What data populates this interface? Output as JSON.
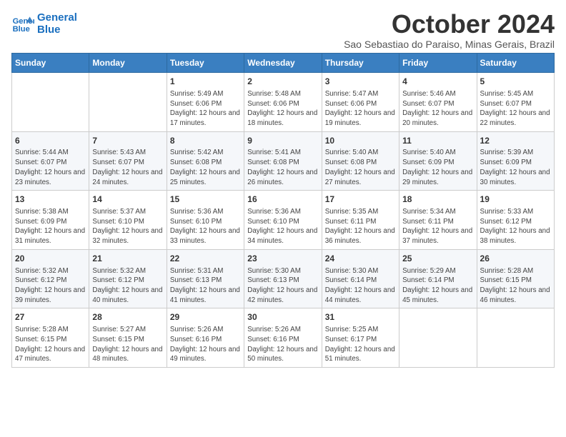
{
  "logo": {
    "line1": "General",
    "line2": "Blue"
  },
  "title": "October 2024",
  "subtitle": "Sao Sebastiao do Paraiso, Minas Gerais, Brazil",
  "weekdays": [
    "Sunday",
    "Monday",
    "Tuesday",
    "Wednesday",
    "Thursday",
    "Friday",
    "Saturday"
  ],
  "weeks": [
    [
      {
        "day": "",
        "info": ""
      },
      {
        "day": "",
        "info": ""
      },
      {
        "day": "1",
        "info": "Sunrise: 5:49 AM\nSunset: 6:06 PM\nDaylight: 12 hours and 17 minutes."
      },
      {
        "day": "2",
        "info": "Sunrise: 5:48 AM\nSunset: 6:06 PM\nDaylight: 12 hours and 18 minutes."
      },
      {
        "day": "3",
        "info": "Sunrise: 5:47 AM\nSunset: 6:06 PM\nDaylight: 12 hours and 19 minutes."
      },
      {
        "day": "4",
        "info": "Sunrise: 5:46 AM\nSunset: 6:07 PM\nDaylight: 12 hours and 20 minutes."
      },
      {
        "day": "5",
        "info": "Sunrise: 5:45 AM\nSunset: 6:07 PM\nDaylight: 12 hours and 22 minutes."
      }
    ],
    [
      {
        "day": "6",
        "info": "Sunrise: 5:44 AM\nSunset: 6:07 PM\nDaylight: 12 hours and 23 minutes."
      },
      {
        "day": "7",
        "info": "Sunrise: 5:43 AM\nSunset: 6:07 PM\nDaylight: 12 hours and 24 minutes."
      },
      {
        "day": "8",
        "info": "Sunrise: 5:42 AM\nSunset: 6:08 PM\nDaylight: 12 hours and 25 minutes."
      },
      {
        "day": "9",
        "info": "Sunrise: 5:41 AM\nSunset: 6:08 PM\nDaylight: 12 hours and 26 minutes."
      },
      {
        "day": "10",
        "info": "Sunrise: 5:40 AM\nSunset: 6:08 PM\nDaylight: 12 hours and 27 minutes."
      },
      {
        "day": "11",
        "info": "Sunrise: 5:40 AM\nSunset: 6:09 PM\nDaylight: 12 hours and 29 minutes."
      },
      {
        "day": "12",
        "info": "Sunrise: 5:39 AM\nSunset: 6:09 PM\nDaylight: 12 hours and 30 minutes."
      }
    ],
    [
      {
        "day": "13",
        "info": "Sunrise: 5:38 AM\nSunset: 6:09 PM\nDaylight: 12 hours and 31 minutes."
      },
      {
        "day": "14",
        "info": "Sunrise: 5:37 AM\nSunset: 6:10 PM\nDaylight: 12 hours and 32 minutes."
      },
      {
        "day": "15",
        "info": "Sunrise: 5:36 AM\nSunset: 6:10 PM\nDaylight: 12 hours and 33 minutes."
      },
      {
        "day": "16",
        "info": "Sunrise: 5:36 AM\nSunset: 6:10 PM\nDaylight: 12 hours and 34 minutes."
      },
      {
        "day": "17",
        "info": "Sunrise: 5:35 AM\nSunset: 6:11 PM\nDaylight: 12 hours and 36 minutes."
      },
      {
        "day": "18",
        "info": "Sunrise: 5:34 AM\nSunset: 6:11 PM\nDaylight: 12 hours and 37 minutes."
      },
      {
        "day": "19",
        "info": "Sunrise: 5:33 AM\nSunset: 6:12 PM\nDaylight: 12 hours and 38 minutes."
      }
    ],
    [
      {
        "day": "20",
        "info": "Sunrise: 5:32 AM\nSunset: 6:12 PM\nDaylight: 12 hours and 39 minutes."
      },
      {
        "day": "21",
        "info": "Sunrise: 5:32 AM\nSunset: 6:12 PM\nDaylight: 12 hours and 40 minutes."
      },
      {
        "day": "22",
        "info": "Sunrise: 5:31 AM\nSunset: 6:13 PM\nDaylight: 12 hours and 41 minutes."
      },
      {
        "day": "23",
        "info": "Sunrise: 5:30 AM\nSunset: 6:13 PM\nDaylight: 12 hours and 42 minutes."
      },
      {
        "day": "24",
        "info": "Sunrise: 5:30 AM\nSunset: 6:14 PM\nDaylight: 12 hours and 44 minutes."
      },
      {
        "day": "25",
        "info": "Sunrise: 5:29 AM\nSunset: 6:14 PM\nDaylight: 12 hours and 45 minutes."
      },
      {
        "day": "26",
        "info": "Sunrise: 5:28 AM\nSunset: 6:15 PM\nDaylight: 12 hours and 46 minutes."
      }
    ],
    [
      {
        "day": "27",
        "info": "Sunrise: 5:28 AM\nSunset: 6:15 PM\nDaylight: 12 hours and 47 minutes."
      },
      {
        "day": "28",
        "info": "Sunrise: 5:27 AM\nSunset: 6:15 PM\nDaylight: 12 hours and 48 minutes."
      },
      {
        "day": "29",
        "info": "Sunrise: 5:26 AM\nSunset: 6:16 PM\nDaylight: 12 hours and 49 minutes."
      },
      {
        "day": "30",
        "info": "Sunrise: 5:26 AM\nSunset: 6:16 PM\nDaylight: 12 hours and 50 minutes."
      },
      {
        "day": "31",
        "info": "Sunrise: 5:25 AM\nSunset: 6:17 PM\nDaylight: 12 hours and 51 minutes."
      },
      {
        "day": "",
        "info": ""
      },
      {
        "day": "",
        "info": ""
      }
    ]
  ]
}
